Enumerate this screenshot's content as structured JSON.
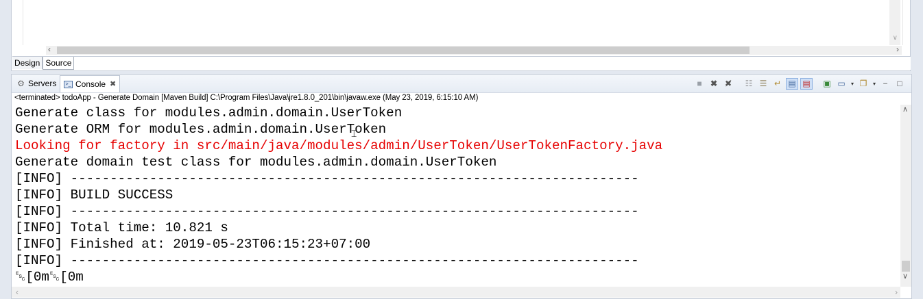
{
  "editor": {
    "tabs": [
      "Design",
      "Source"
    ],
    "active_tab": "Source"
  },
  "view": {
    "tabs": [
      {
        "label": "Servers",
        "icon": "servers-icon"
      },
      {
        "label": "Console",
        "icon": "console-icon",
        "active": true
      }
    ],
    "toolbar_icons": [
      "terminate-icon",
      "remove-launch-icon",
      "remove-all-terminated-icon",
      "clear-console-icon",
      "scroll-lock-icon",
      "word-wrap-icon",
      "show-console-on-stdout-icon",
      "show-console-on-stderr-icon",
      "pin-console-icon",
      "display-selected-console-icon",
      "open-console-icon",
      "minimize-icon",
      "maximize-icon"
    ]
  },
  "console": {
    "process_label": "<terminated> todoApp - Generate Domain [Maven Build] C:\\Program Files\\Java\\jre1.8.0_201\\bin\\javaw.exe (May 23, 2019, 6:15:10 AM)",
    "lines": [
      {
        "text": "Generate class for modules.admin.domain.UserToken",
        "error": false
      },
      {
        "text": "Generate ORM for modules.admin.domain.UserToken",
        "error": false
      },
      {
        "text": "Looking for factory in src/main/java/modules/admin/UserToken/UserTokenFactory.java",
        "error": true
      },
      {
        "text": "Generate domain test class for modules.admin.domain.UserToken",
        "error": false
      },
      {
        "text": "[INFO] ------------------------------------------------------------------------",
        "error": false
      },
      {
        "text": "[INFO] BUILD SUCCESS",
        "error": false
      },
      {
        "text": "[INFO] ------------------------------------------------------------------------",
        "error": false
      },
      {
        "text": "[INFO] Total time: 10.821 s",
        "error": false
      },
      {
        "text": "[INFO] Finished at: 2019-05-23T06:15:23+07:00",
        "error": false
      },
      {
        "text": "[INFO] ------------------------------------------------------------------------",
        "error": false
      },
      {
        "text": "␛[0m␛[0m",
        "error": false
      }
    ],
    "colors": {
      "error": "#e60000",
      "normal": "#000000"
    }
  }
}
